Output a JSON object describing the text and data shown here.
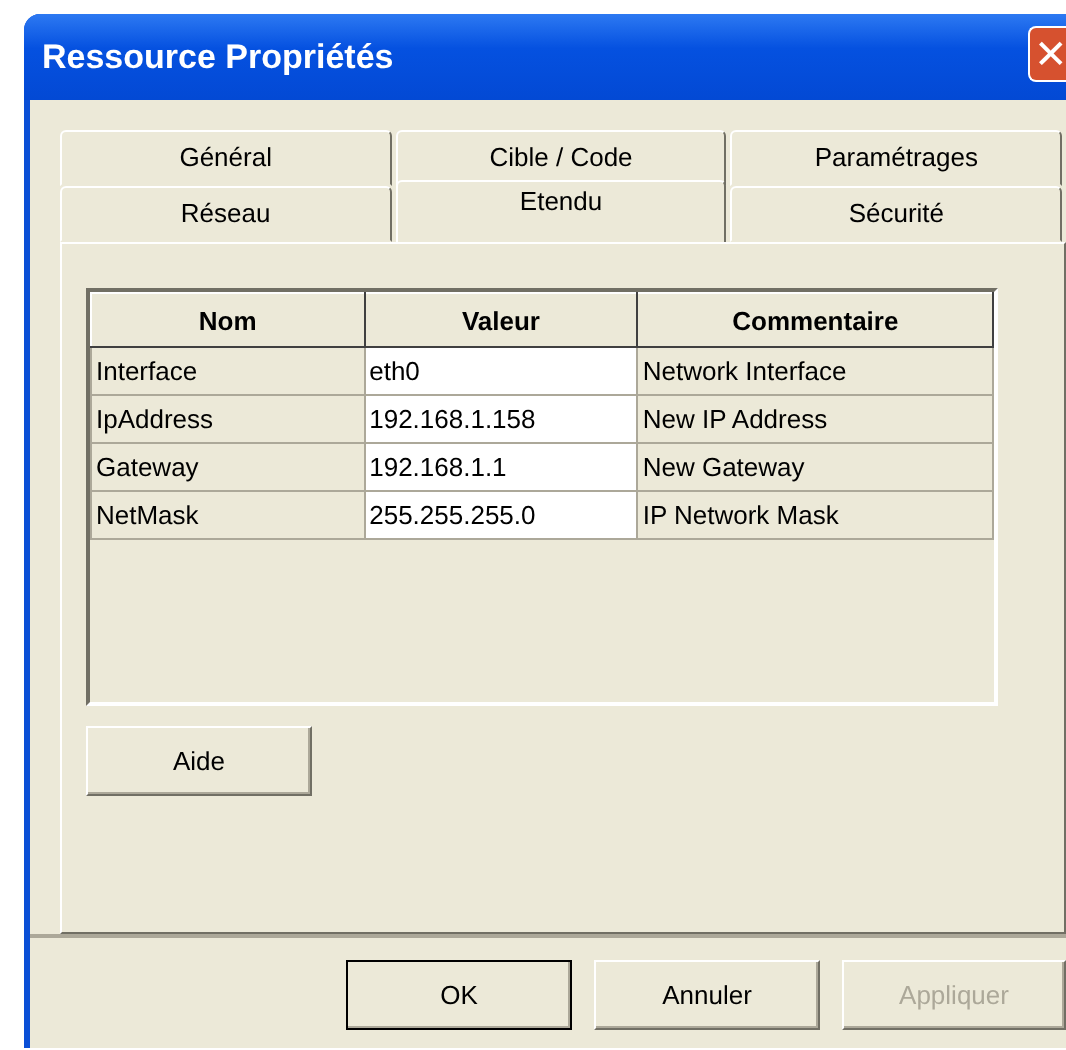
{
  "window": {
    "title": "Ressource Propriétés",
    "close_icon": "✕"
  },
  "tab_rows": [
    {
      "tabs": [
        {
          "label": "Général",
          "selected": false
        },
        {
          "label": "Cible / Code",
          "selected": false
        },
        {
          "label": "Paramétrages",
          "selected": false
        }
      ]
    },
    {
      "tabs": [
        {
          "label": "Réseau",
          "selected": false
        },
        {
          "label": "Etendu",
          "selected": true
        },
        {
          "label": "Sécurité",
          "selected": false
        }
      ]
    }
  ],
  "table": {
    "columns": [
      {
        "label": "Nom",
        "editable": false
      },
      {
        "label": "Valeur",
        "editable": true
      },
      {
        "label": "Commentaire",
        "editable": false
      }
    ],
    "rows": [
      [
        "Interface",
        "eth0",
        "Network Interface"
      ],
      [
        "IpAddress",
        "192.168.1.158",
        "New IP Address"
      ],
      [
        "Gateway",
        "192.168.1.1",
        "New Gateway"
      ],
      [
        "NetMask",
        "255.255.255.0",
        "IP Network Mask"
      ]
    ]
  },
  "help_button": {
    "label": "Aide",
    "disabled": false,
    "default": false
  },
  "buttons": [
    {
      "label": "OK",
      "disabled": false,
      "default": true
    },
    {
      "label": "Annuler",
      "disabled": false,
      "default": false
    },
    {
      "label": "Appliquer",
      "disabled": true,
      "default": false
    }
  ]
}
